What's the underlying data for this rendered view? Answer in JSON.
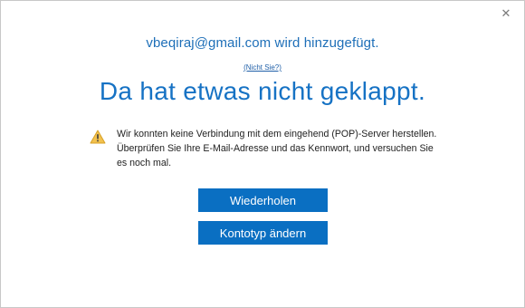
{
  "dialog": {
    "close_glyph": "✕",
    "account_status": "vbeqiraj@gmail.com wird hinzugefügt.",
    "not_you_link": "(Nicht Sie?)",
    "headline": "Da hat etwas nicht geklappt.",
    "message_lines": [
      "Wir konnten keine Verbindung mit dem eingehend (POP)-Server herstellen.",
      "Überprüfen Sie Ihre E-Mail-Adresse und das Kennwort, und versuchen Sie",
      "es noch mal."
    ],
    "warning_icon": "warning-triangle-icon",
    "buttons": {
      "retry_label": "Wiederholen",
      "change_type_label": "Kontotyp ändern"
    }
  },
  "colors": {
    "accent": "#1672c4",
    "button_bg": "#0a6fc2",
    "warning_fill": "#f2c14e",
    "warning_stroke": "#d8a126"
  }
}
